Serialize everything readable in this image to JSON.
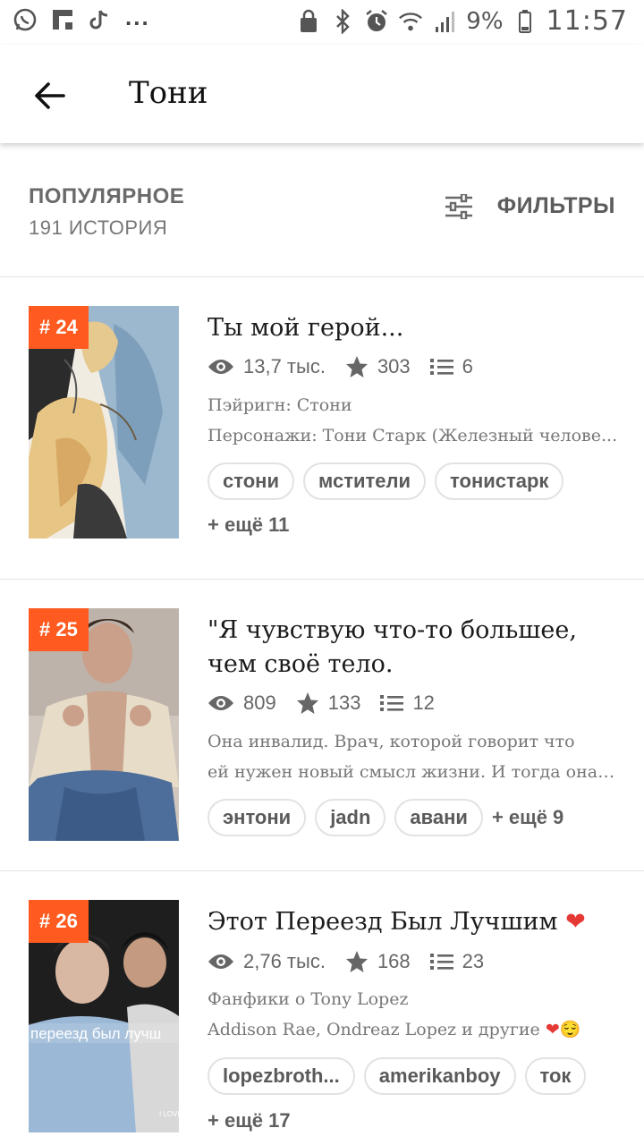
{
  "status_bar": {
    "left_icons": [
      "whatsapp-icon",
      "flipboard-icon",
      "tiktok-icon"
    ],
    "dots": "...",
    "battery": "9%",
    "time": "11:57"
  },
  "app_bar": {
    "title": "Тони"
  },
  "section": {
    "title": "ПОПУЛЯРНОЕ",
    "count": "191 ИСТОРИЯ",
    "filters_label": "ФИЛЬТРЫ"
  },
  "stories": [
    {
      "rank": "# 24",
      "title": "Ты мой герой...",
      "views": "13,7 тыс.",
      "votes": "303",
      "parts": "6",
      "line1": "Пэйригн: Стони",
      "line2": "Персонажи: Тони Старк (Железный челове...",
      "tags": [
        "стони",
        "мстители",
        "тонистарк"
      ],
      "more": "+ ещё 11"
    },
    {
      "rank": "# 25",
      "title": "\"Я чувствую что-то большее, чем своё тело.",
      "views": "809",
      "votes": "133",
      "parts": "12",
      "line1": "Она инвалид. Врач, которой говорит что",
      "line2": "ей нужен новый смысл жизни. И тогда она в...",
      "tags": [
        "энтони",
        "jadn",
        "авани"
      ],
      "more": "+ ещё 9"
    },
    {
      "rank": "# 26",
      "title": "Этот Переезд Был Лучшим",
      "title_emoji": "❤",
      "views": "2,76 тыс.",
      "votes": "168",
      "parts": "23",
      "line1": "Фанфики о Tony Lopez",
      "line2": "Addison Rae, Ondreaz Lopez и другие",
      "line2_emoji": "❤😌",
      "cover_caption": "переезд был лучш",
      "cover_small": "I LOVE",
      "tags": [
        "lopezbroth...",
        "amerikanboy",
        "ток"
      ],
      "more": "+ ещё 17"
    }
  ],
  "colors": {
    "accent_rank": "#ff5a1f",
    "heart": "#e53935"
  }
}
